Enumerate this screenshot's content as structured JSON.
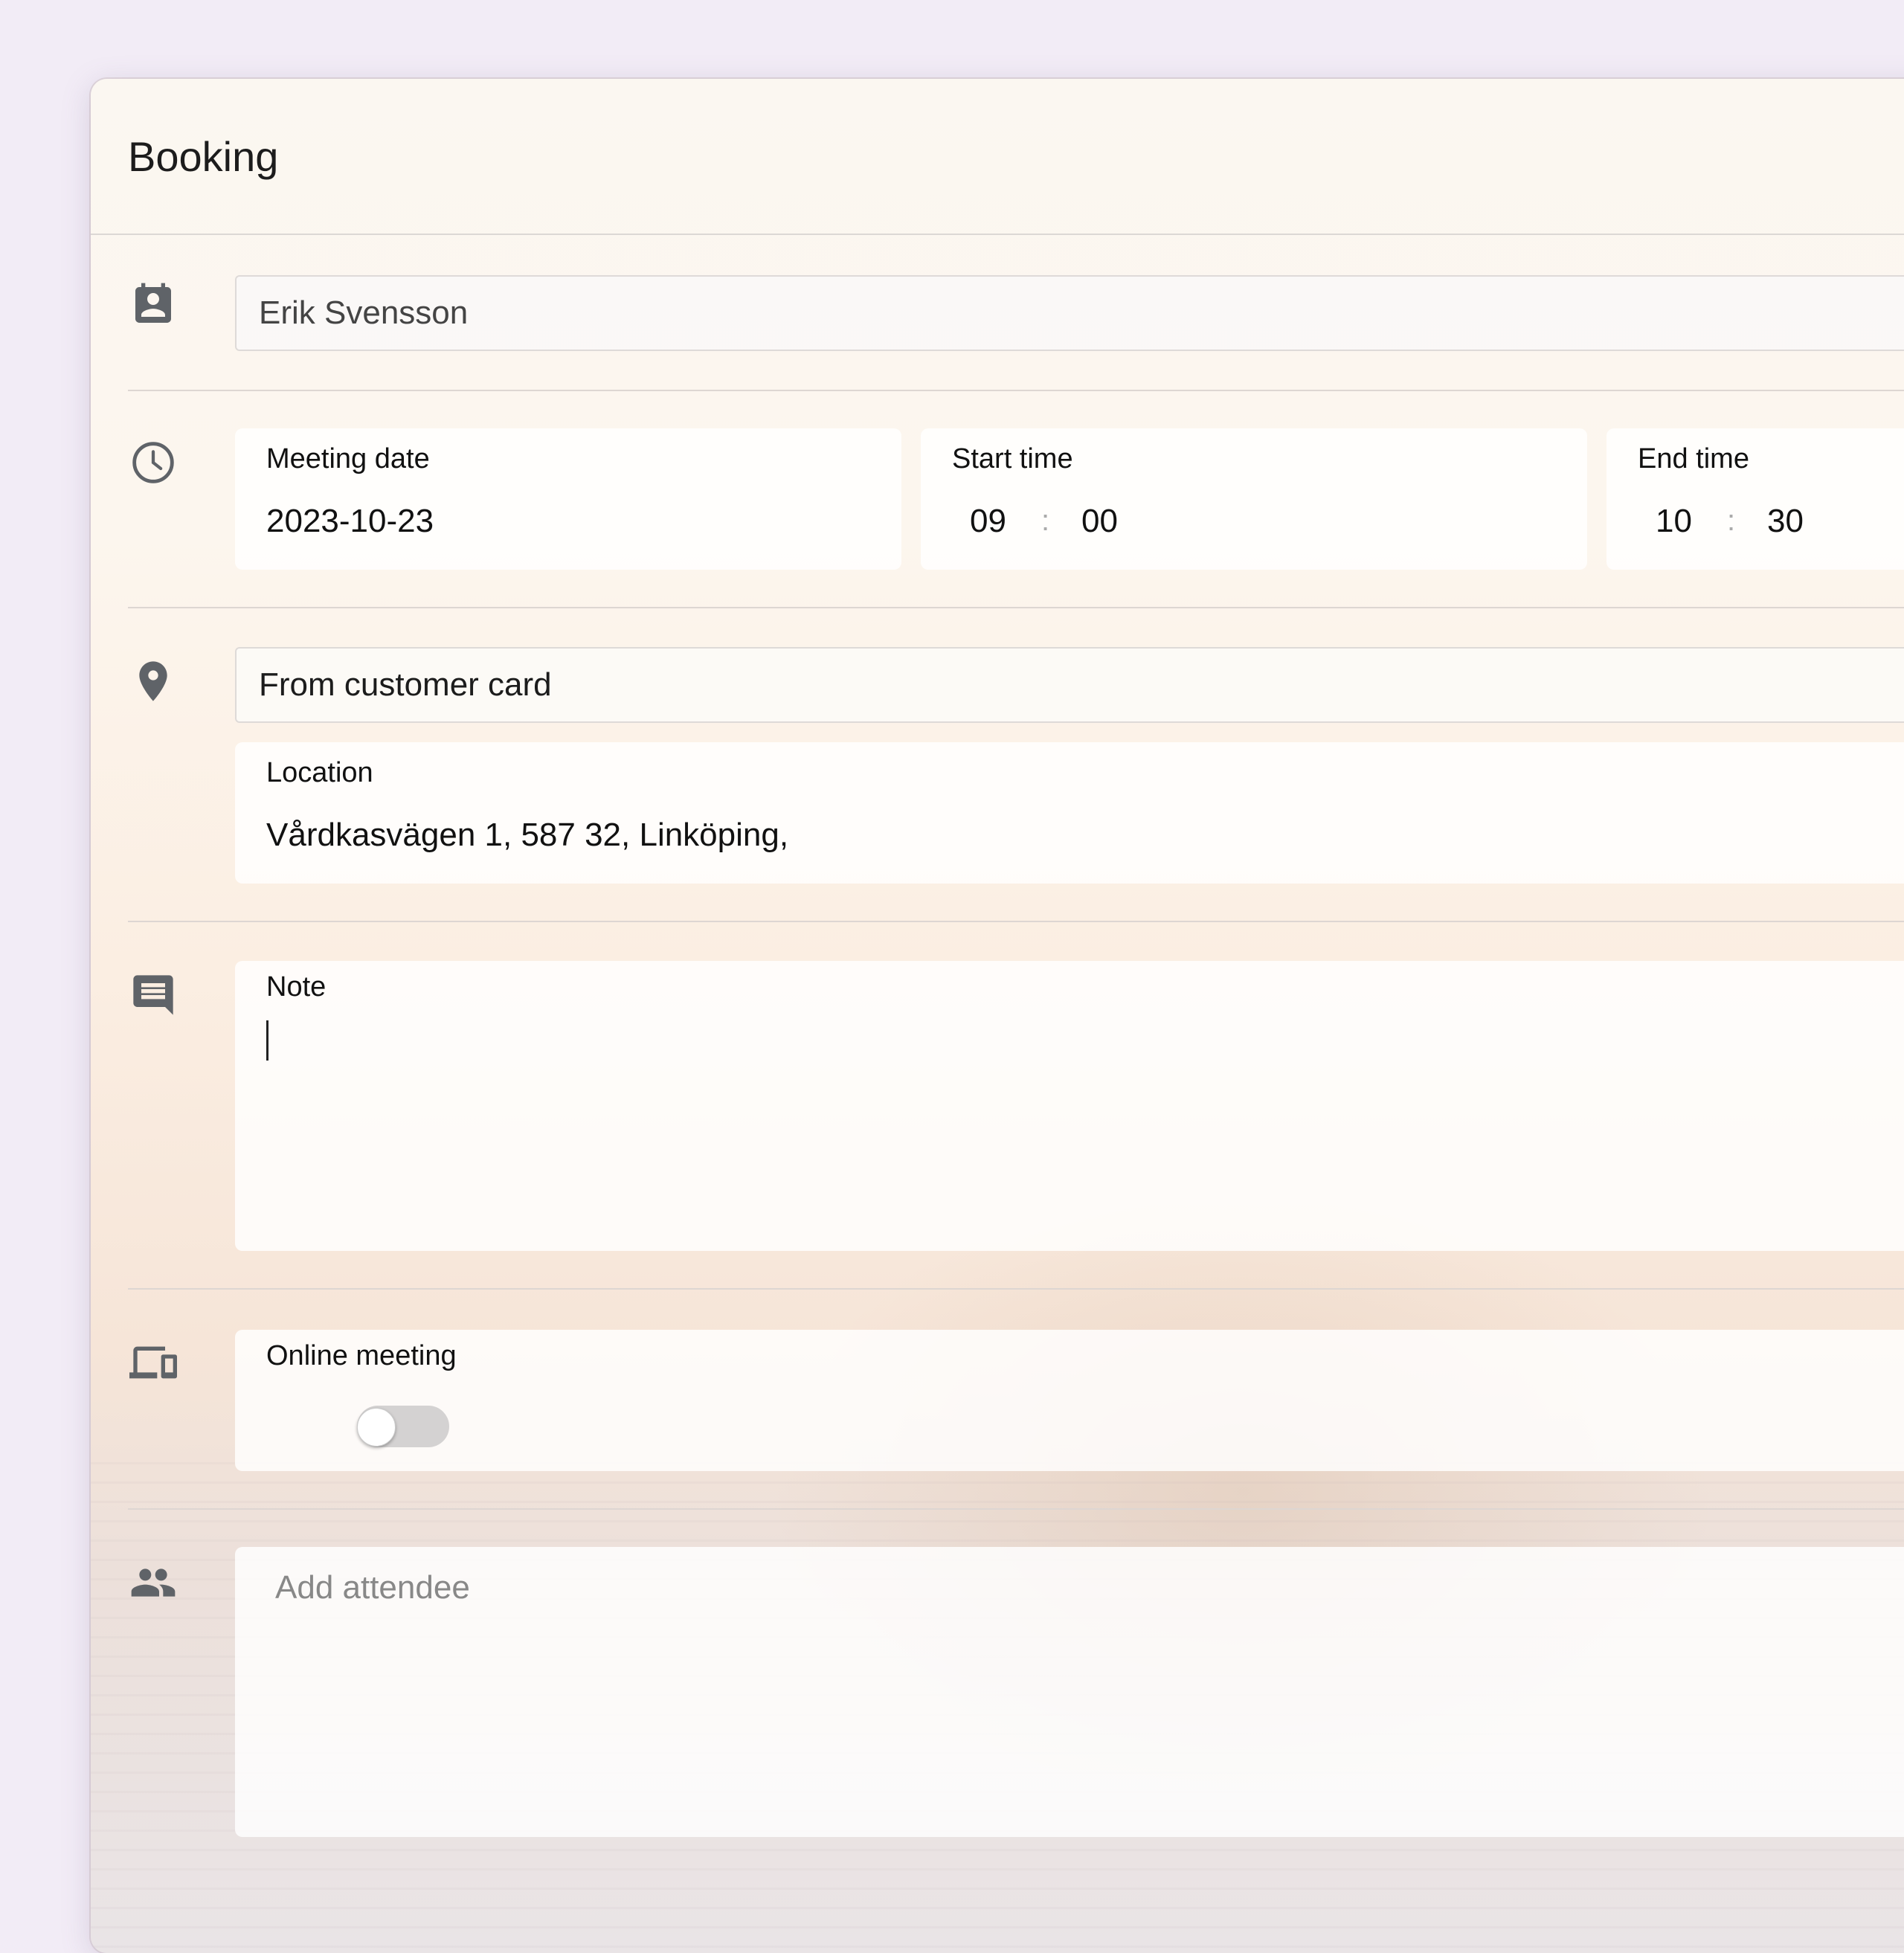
{
  "dialog": {
    "title": "Booking"
  },
  "customer": {
    "name": "Erik Svensson"
  },
  "schedule": {
    "meeting_date_label": "Meeting date",
    "meeting_date": "2023-10-23",
    "start_time_label": "Start time",
    "start_hour": "09",
    "start_minute": "00",
    "end_time_label": "End time",
    "end_hour": "10",
    "end_minute": "30",
    "separator": ":"
  },
  "location": {
    "source": "From customer card",
    "label": "Location",
    "value": "Vårdkasvägen 1, 587 32, Linköping,"
  },
  "note": {
    "label": "Note",
    "value": ""
  },
  "online_meeting": {
    "label": "Online meeting",
    "enabled": false
  },
  "attendees": {
    "placeholder": "Add attendee"
  },
  "icons": {
    "customer": "contact-card-icon",
    "time": "clock-icon",
    "location": "location-pin-icon",
    "note": "comment-icon",
    "online": "devices-icon",
    "attendees": "people-icon"
  },
  "colors": {
    "icon": "#5f6368",
    "background": "#f2ecf6"
  }
}
